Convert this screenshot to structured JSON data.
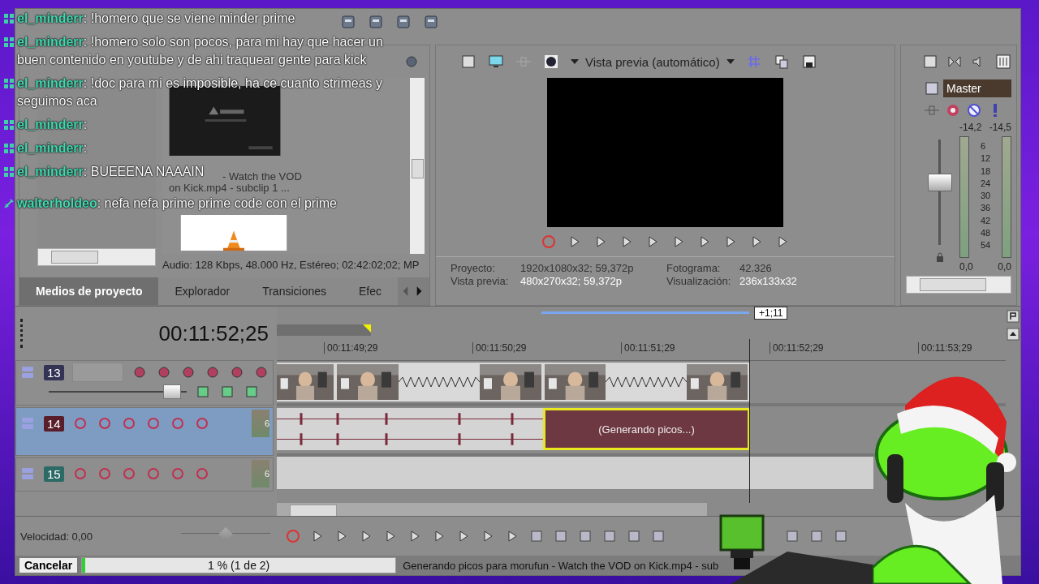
{
  "chat": [
    {
      "kind": "grid",
      "user": "el_minderr",
      "message": ": !homero que se viene minder prime"
    },
    {
      "kind": "grid",
      "user": "el_minderr",
      "message": ": !homero solo son pocos, para mi hay que hacer un buen contenido en youtube y de ahi traquear gente para kick"
    },
    {
      "kind": "grid",
      "user": "el_minderr",
      "message": ": !doc para mi es imposible, ha ce cuanto strimeas y seguimos aca"
    },
    {
      "kind": "grid",
      "user": "el_minderr",
      "message": ":"
    },
    {
      "kind": "grid",
      "user": "el_minderr",
      "message": ":"
    },
    {
      "kind": "grid",
      "user": "el_minderr",
      "message": ": BUEEENA NAAAIN"
    },
    {
      "kind": "sword",
      "user": "walterholdeo",
      "message": ": nefa nefa prime prime code con el prime"
    }
  ],
  "media": {
    "caption": [
      "- Watch the VOD",
      "on Kick.mp4 - subclip 1 ..."
    ],
    "info": "Audio: 128 Kbps, 48.000 Hz, Estéreo; 02:42:02;02; MP",
    "tabs": [
      {
        "label": "Medios de proyecto",
        "selected": true
      },
      {
        "label": "Explorador",
        "selected": false
      },
      {
        "label": "Transiciones",
        "selected": false
      },
      {
        "label": "Efec",
        "selected": false
      }
    ]
  },
  "preview": {
    "mode": "Vista previa (automático)",
    "info": [
      {
        "label": "Proyecto:",
        "value": "1920x1080x32; 59,372p"
      },
      {
        "label": "Vista previa:",
        "value": "480x270x32; 59,372p"
      },
      {
        "label": "Fotograma:",
        "value": "42.326"
      },
      {
        "label": "Visualización:",
        "value": "236x133x32"
      }
    ]
  },
  "mixer": {
    "title": "Master",
    "peaks": [
      "-14,2",
      "-14,5"
    ],
    "scale": [
      "6",
      "12",
      "18",
      "24",
      "30",
      "36",
      "42",
      "48",
      "54"
    ],
    "fader": {
      "level": 0.6
    },
    "readings": [
      "0,0",
      "0,0"
    ]
  },
  "timeline": {
    "time": "00:11:52;25",
    "loop_length": "+1;11",
    "ruler": [
      "00:11:49;29",
      "00:11:50;29",
      "00:11:51;29",
      "00:11:52;29",
      "00:11:53;29"
    ],
    "tracks": [
      {
        "kind": "video",
        "number": "13",
        "selected": false,
        "level": 0.95
      },
      {
        "kind": "audio",
        "number": "14",
        "selected": true,
        "meter": "6"
      },
      {
        "kind": "audio",
        "number": "15",
        "selected": false,
        "meter": "6"
      }
    ],
    "event_label": "(Generando picos...)",
    "speed": "Velocidad: 0,00",
    "shuttle": {
      "level": 0.5
    }
  },
  "status": {
    "cancel": "Cancelar",
    "progress": "1 % (1 de 2)",
    "level": 0.01,
    "message": "Generando picos para morufun - Watch the VOD on Kick.mp4 - sub"
  }
}
